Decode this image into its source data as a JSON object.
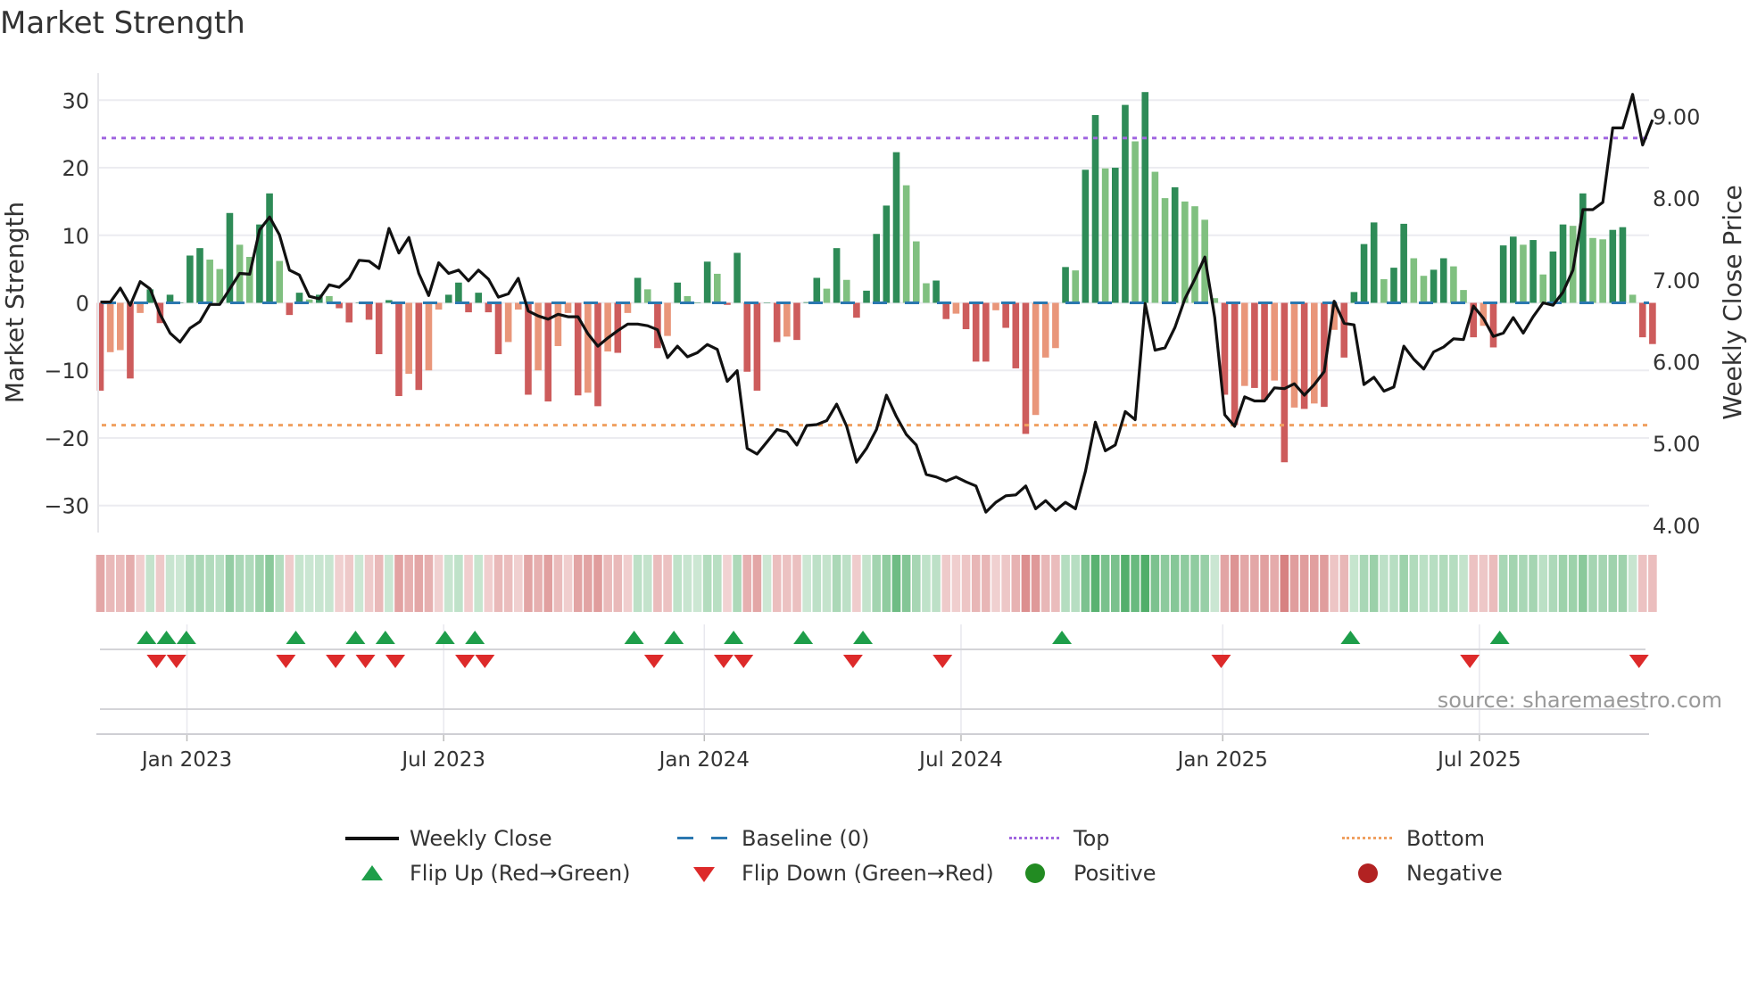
{
  "title": "Market Strength",
  "source": "source: sharemaestro.com",
  "legend": [
    {
      "label": "Weekly Close",
      "icon": "solid-line",
      "color": "#111111"
    },
    {
      "label": "Baseline (0)",
      "icon": "dashed-line",
      "color": "#2b78b0"
    },
    {
      "label": "Top",
      "icon": "dotted-line",
      "color": "#a066e0"
    },
    {
      "label": "Bottom",
      "icon": "dotted-line",
      "color": "#f0a060"
    },
    {
      "label": "Flip Up (Red→Green)",
      "icon": "triangle-up",
      "color": "#1e9e4a"
    },
    {
      "label": "Flip Down (Green→Red)",
      "icon": "triangle-down",
      "color": "#dd2a2a"
    },
    {
      "label": "Positive",
      "icon": "circle",
      "color": "#228b22"
    },
    {
      "label": "Negative",
      "icon": "circle",
      "color": "#b22222"
    }
  ],
  "colors": {
    "pos_strong": "#2e8b57",
    "pos_weak": "#80c080",
    "neg_strong": "#cd5c5c",
    "neg_weak": "#e9967a",
    "price": "#111111",
    "baseline": "#2b78b0",
    "top": "#a066e0",
    "bottom": "#f0a060",
    "flip_up": "#1e9e4a",
    "flip_down": "#dd2a2a"
  },
  "chart_data": {
    "type": "bar+line",
    "title": "Market Strength",
    "ylabel": "Market Strength",
    "y2label": "Weekly Close Price",
    "ylim": [
      -34,
      34
    ],
    "y2lim": [
      3.91,
      9.53
    ],
    "yticks": [
      30,
      20,
      10,
      0,
      -10,
      -20,
      -30
    ],
    "ytick_labels": [
      "30",
      "20",
      "10",
      "0",
      "−10",
      "−20",
      "−30"
    ],
    "y2ticks": [
      9,
      8,
      7,
      6,
      5,
      4
    ],
    "y2tick_labels": [
      "9.00",
      "8.00",
      "7.00",
      "6.00",
      "5.00",
      "4.00"
    ],
    "x_unit": "week index",
    "x_ticks": [
      {
        "label": "Jan 2023",
        "week": 8.7
      },
      {
        "label": "Jul 2023",
        "week": 34.5
      },
      {
        "label": "Jan 2024",
        "week": 60.7
      },
      {
        "label": "Jul 2024",
        "week": 86.5
      },
      {
        "label": "Jan 2025",
        "week": 112.8
      },
      {
        "label": "Jul 2025",
        "week": 138.6
      }
    ],
    "top_level": 24.4,
    "bottom_level": -18.1,
    "baseline": 0,
    "grid": "horizontal",
    "legend_position": "bottom",
    "strength": [
      -13,
      -7.3,
      -7,
      -11.2,
      -1.5,
      2,
      -3,
      1.2,
      0,
      7,
      8.1,
      6.4,
      5,
      13.3,
      8.6,
      6.8,
      11.6,
      16.2,
      6.2,
      -1.8,
      1.5,
      0.5,
      1.2,
      1.0,
      -0.8,
      -2.9,
      0,
      -2.5,
      -7.6,
      0.4,
      -13.8,
      -10.5,
      -12.9,
      -10,
      -1,
      1.2,
      3,
      -1.4,
      1.5,
      -1.4,
      -7.6,
      -5.8,
      -1,
      -13.6,
      -10,
      -14.6,
      -6.4,
      -1.5,
      -13.7,
      -13.3,
      -15.3,
      -7.2,
      -7.4,
      -1.5,
      3.7,
      2.0,
      -6.7,
      -4.9,
      3.0,
      1.0,
      0,
      6.1,
      4.3,
      -0.3,
      7.4,
      -10.2,
      -13.0,
      0,
      -5.8,
      -5.0,
      -5.5,
      0.1,
      3.7,
      2.1,
      8.1,
      3.4,
      -2.2,
      1.8,
      10.2,
      14.4,
      22.3,
      17.4,
      9.1,
      2.9,
      3.3,
      -2.4,
      -1.6,
      -3.9,
      -8.7,
      -8.7,
      -1.1,
      -3.7,
      -9.7,
      -19.4,
      -16.6,
      -8.1,
      -6.7,
      5.3,
      4.8,
      19.7,
      27.8,
      19.9,
      20.0,
      29.3,
      23.9,
      31.2,
      19.4,
      15.5,
      17.1,
      15.0,
      14.3,
      12.3,
      0.7,
      -13.6,
      -18.1,
      -12.3,
      -12.6,
      -14.4,
      -11.5,
      -23.6,
      -15.5,
      -15.7,
      -14.9,
      -15.4,
      -4.0,
      -8.1,
      1.6,
      8.7,
      11.9,
      3.5,
      5.2,
      11.7,
      6.6,
      4.0,
      4.9,
      6.6,
      5.4,
      1.9,
      -5.1,
      -3.4,
      -6.6,
      8.5,
      9.8,
      8.6,
      9.3,
      4.2,
      7.6,
      11.6,
      11.4,
      16.2,
      9.6,
      9.4,
      10.8,
      11.2,
      1.2,
      -5.1,
      -6.1
    ],
    "weekly_close": [
      6.73,
      6.73,
      6.9,
      6.69,
      6.98,
      6.89,
      6.58,
      6.35,
      6.24,
      6.41,
      6.49,
      6.7,
      6.7,
      6.89,
      7.08,
      7.07,
      7.61,
      7.77,
      7.55,
      7.12,
      7.06,
      6.8,
      6.77,
      6.94,
      6.91,
      7.02,
      7.24,
      7.23,
      7.14,
      7.63,
      7.33,
      7.52,
      7.08,
      6.81,
      7.21,
      7.08,
      7.12,
      6.99,
      7.12,
      7.01,
      6.79,
      6.83,
      7.02,
      6.62,
      6.56,
      6.52,
      6.58,
      6.55,
      6.55,
      6.34,
      6.19,
      6.29,
      6.38,
      6.46,
      6.46,
      6.44,
      6.39,
      6.05,
      6.19,
      6.06,
      6.11,
      6.21,
      6.15,
      5.76,
      5.89,
      4.94,
      4.87,
      5.02,
      5.17,
      5.14,
      4.98,
      5.22,
      5.23,
      5.28,
      5.48,
      5.21,
      4.77,
      4.94,
      5.17,
      5.59,
      5.33,
      5.11,
      4.98,
      4.62,
      4.59,
      4.54,
      4.59,
      4.53,
      4.48,
      4.16,
      4.28,
      4.36,
      4.37,
      4.48,
      4.2,
      4.3,
      4.18,
      4.28,
      4.2,
      4.66,
      5.26,
      4.91,
      4.98,
      5.39,
      5.29,
      6.71,
      6.14,
      6.17,
      6.42,
      6.77,
      7.01,
      7.28,
      6.54,
      5.35,
      5.21,
      5.57,
      5.52,
      5.52,
      5.68,
      5.67,
      5.73,
      5.59,
      5.72,
      5.88,
      6.74,
      6.47,
      6.45,
      5.72,
      5.81,
      5.64,
      5.69,
      6.19,
      6.03,
      5.91,
      6.12,
      6.18,
      6.28,
      6.27,
      6.68,
      6.53,
      6.31,
      6.35,
      6.54,
      6.35,
      6.55,
      6.72,
      6.69,
      6.85,
      7.12,
      7.86,
      7.86,
      7.95,
      8.86,
      8.86,
      9.27,
      8.65,
      8.96
    ],
    "flip_up_weeks": [
      5,
      7,
      9,
      20,
      26,
      29,
      35,
      38,
      54,
      58,
      64,
      71,
      77,
      97,
      126,
      141
    ],
    "flip_down_weeks": [
      6,
      8,
      19,
      24,
      27,
      30,
      37,
      39,
      56,
      63,
      65,
      76,
      85,
      113,
      138,
      155
    ]
  }
}
